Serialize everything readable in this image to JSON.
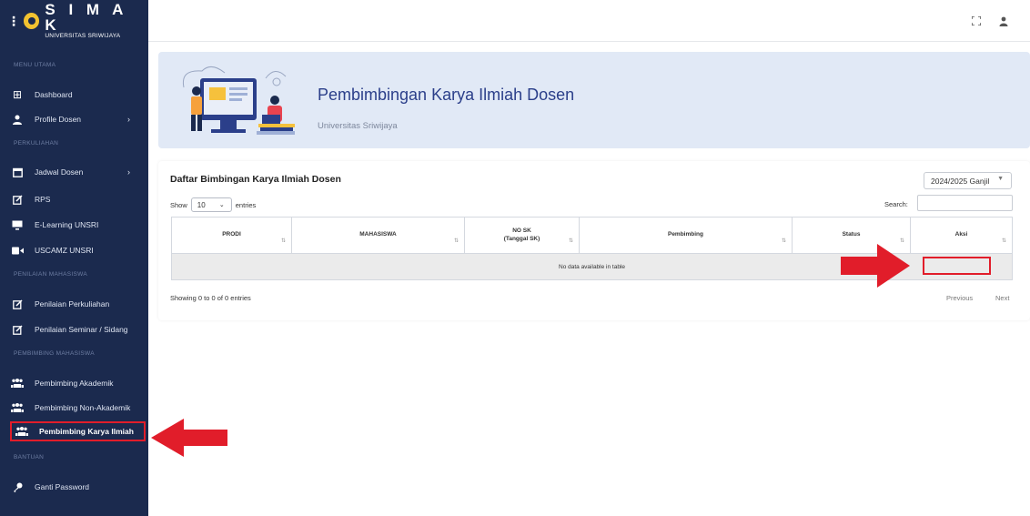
{
  "brand": {
    "name": "S I M A K",
    "subtitle": "UNIVERSITAS SRIWIJAYA"
  },
  "sidebar": {
    "sections": [
      {
        "label": "MENU UTAMA"
      },
      {
        "label": "PERKULIAHAN"
      },
      {
        "label": "PENILAIAN MAHASISWA"
      },
      {
        "label": "PEMBIMBING MAHASISWA"
      },
      {
        "label": "BANTUAN"
      }
    ],
    "items": [
      {
        "label": "Dashboard",
        "icon": "grid-icon"
      },
      {
        "label": "Profile Dosen",
        "icon": "user-icon"
      },
      {
        "label": "Jadwal Dosen",
        "icon": "calendar-icon"
      },
      {
        "label": "RPS",
        "icon": "edit-icon"
      },
      {
        "label": "E-Learning UNSRI",
        "icon": "monitor-icon"
      },
      {
        "label": "USCAMZ UNSRI",
        "icon": "video-icon"
      },
      {
        "label": "Penilaian Perkuliahan",
        "icon": "edit-icon"
      },
      {
        "label": "Penilaian Seminar / Sidang",
        "icon": "edit-icon"
      },
      {
        "label": "Pembimbing Akademik",
        "icon": "users-icon"
      },
      {
        "label": "Pembimbing Non-Akademik",
        "icon": "users-icon"
      },
      {
        "label": "Pembimbing Karya Ilmiah",
        "icon": "users-icon"
      },
      {
        "label": "Ganti Password",
        "icon": "key-icon"
      }
    ],
    "active_item": "Pembimbing Karya Ilmiah"
  },
  "banner": {
    "title": "Pembimbingan Karya Ilmiah Dosen",
    "subtitle": "Universitas Sriwijaya"
  },
  "card": {
    "title": "Daftar Bimbingan Karya Ilmiah Dosen",
    "semester": "2024/2025 Ganjil",
    "show_label": "Show",
    "page_length": "10",
    "entries_label": "entries",
    "search_label": "Search:",
    "search_value": "",
    "columns": [
      {
        "label": "PRODI",
        "sub": ""
      },
      {
        "label": "MAHASISWA",
        "sub": ""
      },
      {
        "label": "NO SK",
        "sub": "(Tanggal SK)"
      },
      {
        "label": "Pembimbing",
        "sub": ""
      },
      {
        "label": "Status",
        "sub": ""
      },
      {
        "label": "Aksi",
        "sub": ""
      }
    ],
    "empty_text": "No data available in table",
    "info": "Showing 0 to 0 of 0 entries",
    "prev": "Previous",
    "next": "Next"
  },
  "colors": {
    "sidebar": "#1b2a4e",
    "accent": "#2b3f8a",
    "highlight": "#e11d2a",
    "banner_bg": "#e1e9f6"
  }
}
